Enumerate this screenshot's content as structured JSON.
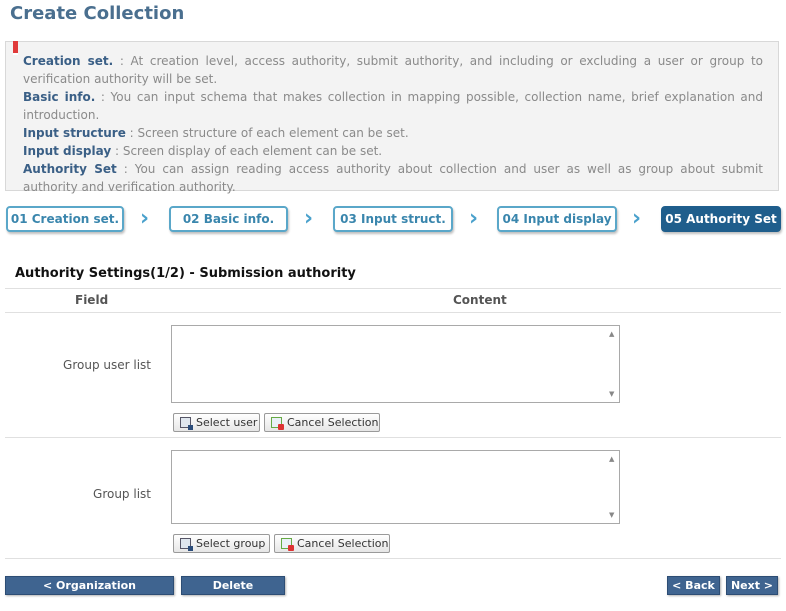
{
  "page": {
    "title": "Create Collection"
  },
  "info": {
    "items": [
      {
        "term": "Creation set.",
        "desc": " : At creation level, access authority, submit authority, and including or excluding a user or group to verification authority will be set."
      },
      {
        "term": "Basic info.",
        "desc": " : You can input schema that makes collection in mapping possible, collection name, brief explanation and introduction."
      },
      {
        "term": "Input structure",
        "desc": " : Screen structure of each element can be set."
      },
      {
        "term": "Input display",
        "desc": " : Screen display of each element can be set."
      },
      {
        "term": "Authority Set",
        "desc": " : You can assign reading access authority about collection and user as well as group about submit authority and verification authority."
      }
    ]
  },
  "steps": [
    {
      "label": "01 Creation set."
    },
    {
      "label": "02 Basic info."
    },
    {
      "label": "03 Input struct."
    },
    {
      "label": "04 Input display"
    },
    {
      "label": "05 Authority Set"
    }
  ],
  "section": {
    "title": "Authority Settings(1/2) - Submission authority",
    "col_field": "Field",
    "col_content": "Content",
    "rows": [
      {
        "label": "Group user list",
        "select_label": "Select user",
        "cancel_label": "Cancel Selection"
      },
      {
        "label": "Group list",
        "select_label": "Select group",
        "cancel_label": "Cancel Selection"
      }
    ]
  },
  "footer": {
    "org_mgmt": "< Organization Management",
    "delete": "Delete Collection",
    "back": "< Back",
    "next": "Next >"
  }
}
